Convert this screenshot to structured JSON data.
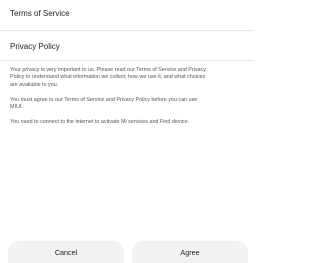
{
  "links": {
    "terms_of_service": "Terms of Service",
    "privacy_policy": "Privacy Policy"
  },
  "paragraphs": [
    {
      "lines": [
        "Your privacy is very important to us. Please read our Terms of Service and Privacy",
        "Policy to understand what information we collect, how we use it, and what choices",
        "are available to you."
      ]
    },
    {
      "lines": [
        "You must agree to our Terms of Service and Privacy Policy before you can use",
        "MIUI."
      ]
    },
    {
      "lines": [
        "You need to connect to the internet to activate Mi services and Find device."
      ]
    }
  ],
  "buttons": {
    "cancel": "Cancel",
    "agree": "Agree"
  },
  "colors": {
    "background": "#ffffff",
    "divider": "#e6e6e6",
    "button_background": "#f2f2f2",
    "body_text": "#555555",
    "primary_text": "#222222"
  }
}
